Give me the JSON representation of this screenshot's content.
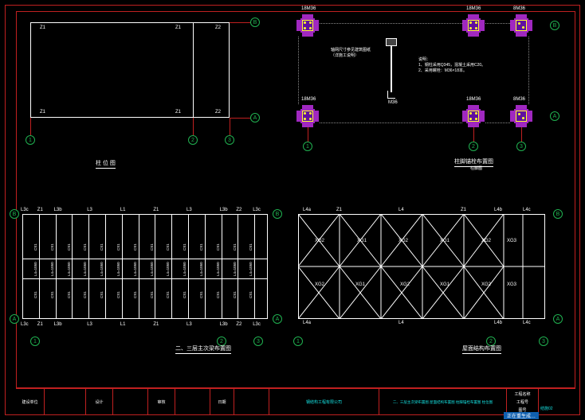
{
  "grid_axes": {
    "num": [
      "1",
      "2",
      "3"
    ],
    "let": [
      "A",
      "B"
    ]
  },
  "member_labels": {
    "z1": "Z1",
    "z2": "Z2",
    "l1": "L1",
    "l3": "L3",
    "l3b": "L3b",
    "l3c": "L3c",
    "l4": "L4",
    "l4a": "L4a",
    "l4b": "L4b",
    "l4c": "L4c",
    "cs1": "CS1",
    "xg1": "XG1",
    "xg2": "XG2",
    "xg3": "XG3"
  },
  "bolt_label_18": "18M36",
  "bolt_label_8": "8M36",
  "anchor_detail": "M36",
  "notes_title": "说明：",
  "note1": "1、钢柱采用Q345，混凝土采用C20。",
  "note2": "2、采用螺栓：M36×18本。",
  "note3": "轴网尺寸参见建筑图纸",
  "note4": "（详施工说明）",
  "caption_tl": "柱 位 图",
  "caption_tr": "柱脚锚栓布置图",
  "caption_tr2": "柱脚图",
  "caption_bl": "二、三层主次梁布置图",
  "caption_br": "屋面结构布置图",
  "titleblock": {
    "project_lbl": "建设单位",
    "design_lbl": "设计",
    "chk_lbl": "审核",
    "date_lbl": "日期",
    "company": "钢结构工程有限公司",
    "dwg_titles": "二、三层主次梁布置图   屋面结构布置图   柱脚锚栓布置图   柱位图",
    "stage_lbl": "工程名称",
    "no_lbl": "工程号",
    "sheet_lbl": "图号",
    "sheet": "结施02"
  },
  "build_tag": "正在重生成…",
  "chart_data": {
    "type": "diagram",
    "drawings": [
      {
        "name": "柱位图",
        "grid_x": [
          0,
          9000,
          12000
        ],
        "grid_y": [
          0,
          4500
        ],
        "columns": [
          [
            1,
            "A",
            "Z1"
          ],
          [
            1,
            "B",
            "Z1"
          ],
          [
            2,
            "A",
            "Z1"
          ],
          [
            2,
            "B",
            "Z1"
          ],
          [
            3,
            "A",
            "Z2"
          ],
          [
            3,
            "B",
            "Z2"
          ]
        ]
      },
      {
        "name": "柱脚锚栓布置图",
        "nodes": [
          {
            "grid": "1/A",
            "bolt": "18M36"
          },
          {
            "grid": "1/B",
            "bolt": "18M36"
          },
          {
            "grid": "2/A",
            "bolt": "18M36"
          },
          {
            "grid": "2/B",
            "bolt": "18M36"
          },
          {
            "grid": "3/A",
            "bolt": "8M36"
          },
          {
            "grid": "3/B",
            "bolt": "8M36"
          }
        ],
        "anchor_detail": "M36"
      },
      {
        "name": "二、三层主次梁布置图",
        "mains": [
          "L1",
          "L3",
          "L3b",
          "L3c"
        ],
        "secondary": "CS1",
        "column": "Z1",
        "bays": 14
      },
      {
        "name": "屋面结构布置图",
        "mains": [
          "L4a",
          "L4",
          "L4b",
          "L4c"
        ],
        "bracing": [
          "XG1",
          "XG2",
          "XG3"
        ],
        "column": "Z1",
        "bays": 6
      }
    ]
  }
}
